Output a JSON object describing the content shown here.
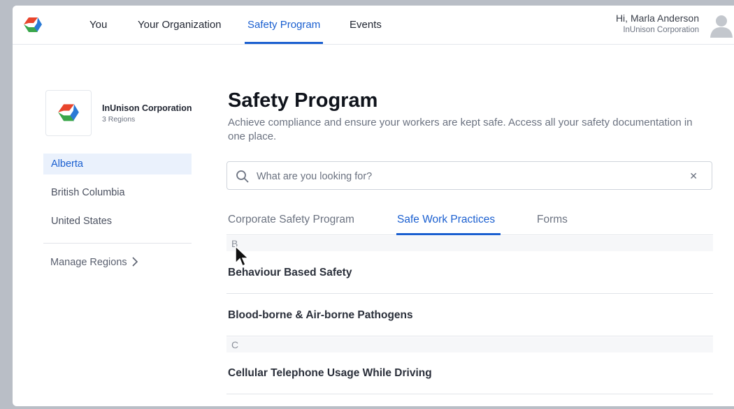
{
  "nav": {
    "items": [
      {
        "label": "You"
      },
      {
        "label": "Your Organization"
      },
      {
        "label": "Safety Program"
      },
      {
        "label": "Events"
      }
    ],
    "active_index": 2,
    "user_greeting": "Hi, Marla Anderson",
    "user_org": "InUnison Corporation",
    "logo_icon": "inunison-logo-icon",
    "avatar_icon": "user-avatar-icon"
  },
  "sidebar": {
    "org_name": "InUnison Corporation",
    "org_regions": "3 Regions",
    "regions": [
      {
        "label": "Alberta",
        "active": true
      },
      {
        "label": "British Columbia",
        "active": false
      },
      {
        "label": "United States",
        "active": false
      }
    ],
    "manage_label": "Manage Regions"
  },
  "main": {
    "title": "Safety Program",
    "description": "Achieve compliance and ensure your workers are kept safe. Access all your safety documentation in one place.",
    "search": {
      "placeholder": "What are you looking for?",
      "value": ""
    },
    "tabs": [
      {
        "label": "Corporate Safety Program"
      },
      {
        "label": "Safe Work Practices"
      },
      {
        "label": "Forms"
      }
    ],
    "active_tab": 1,
    "sections": [
      {
        "letter": "B",
        "items": [
          "Behaviour Based Safety",
          "Blood-borne & Air-borne Pathogens"
        ]
      },
      {
        "letter": "C",
        "items": [
          "Cellular Telephone Usage While Driving"
        ]
      }
    ]
  },
  "colors": {
    "accent": "#1a5fd0",
    "logo_red": "#e8452c",
    "logo_blue": "#2a7ad6",
    "logo_green": "#3aa64a"
  }
}
